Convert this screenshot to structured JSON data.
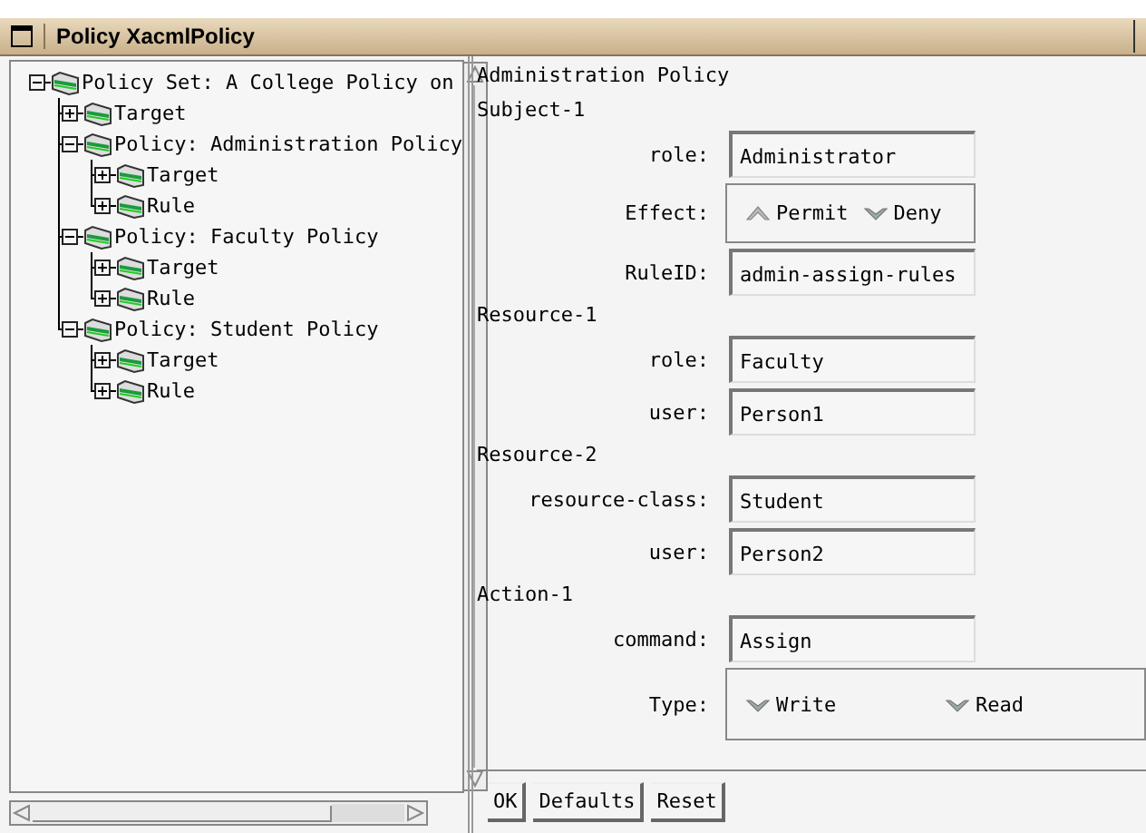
{
  "window": {
    "title": "Policy XacmlPolicy"
  },
  "tree": [
    {
      "label": "Policy Set: A College Policy on",
      "expanded": true,
      "children": [
        {
          "label": "Target",
          "expanded": false
        },
        {
          "label": "Policy: Administration Policy",
          "expanded": true,
          "children": [
            {
              "label": "Target",
              "expanded": false
            },
            {
              "label": "Rule",
              "expanded": false
            }
          ]
        },
        {
          "label": "Policy: Faculty Policy",
          "expanded": true,
          "children": [
            {
              "label": "Target",
              "expanded": false
            },
            {
              "label": "Rule",
              "expanded": false
            }
          ]
        },
        {
          "label": "Policy: Student Policy",
          "expanded": true,
          "children": [
            {
              "label": "Target",
              "expanded": false
            },
            {
              "label": "Rule",
              "expanded": false
            }
          ]
        }
      ]
    }
  ],
  "form": {
    "title": "Administration Policy",
    "rows": [
      {
        "kind": "heading",
        "text": "Subject-1"
      },
      {
        "kind": "field",
        "label": "role:",
        "value": "Administrator"
      },
      {
        "kind": "radio",
        "label": "Effect:",
        "options": [
          {
            "label": "Permit",
            "selected": true
          },
          {
            "label": "Deny",
            "selected": false
          }
        ]
      },
      {
        "kind": "field",
        "label": "RuleID:",
        "value": "admin-assign-rules"
      },
      {
        "kind": "heading",
        "text": "Resource-1"
      },
      {
        "kind": "field",
        "label": "role:",
        "value": "Faculty"
      },
      {
        "kind": "field",
        "label": "user:",
        "value": "Person1"
      },
      {
        "kind": "heading",
        "text": "Resource-2"
      },
      {
        "kind": "field",
        "label": "resource-class:",
        "value": "Student"
      },
      {
        "kind": "field",
        "label": "user:",
        "value": "Person2"
      },
      {
        "kind": "heading",
        "text": "Action-1"
      },
      {
        "kind": "field",
        "label": "command:",
        "value": "Assign"
      },
      {
        "kind": "radio",
        "label": "Type:",
        "options": [
          {
            "label": "Write",
            "selected": false
          },
          {
            "label": "Read",
            "selected": false
          }
        ]
      }
    ]
  },
  "buttons": [
    "OK",
    "Defaults",
    "Reset"
  ]
}
